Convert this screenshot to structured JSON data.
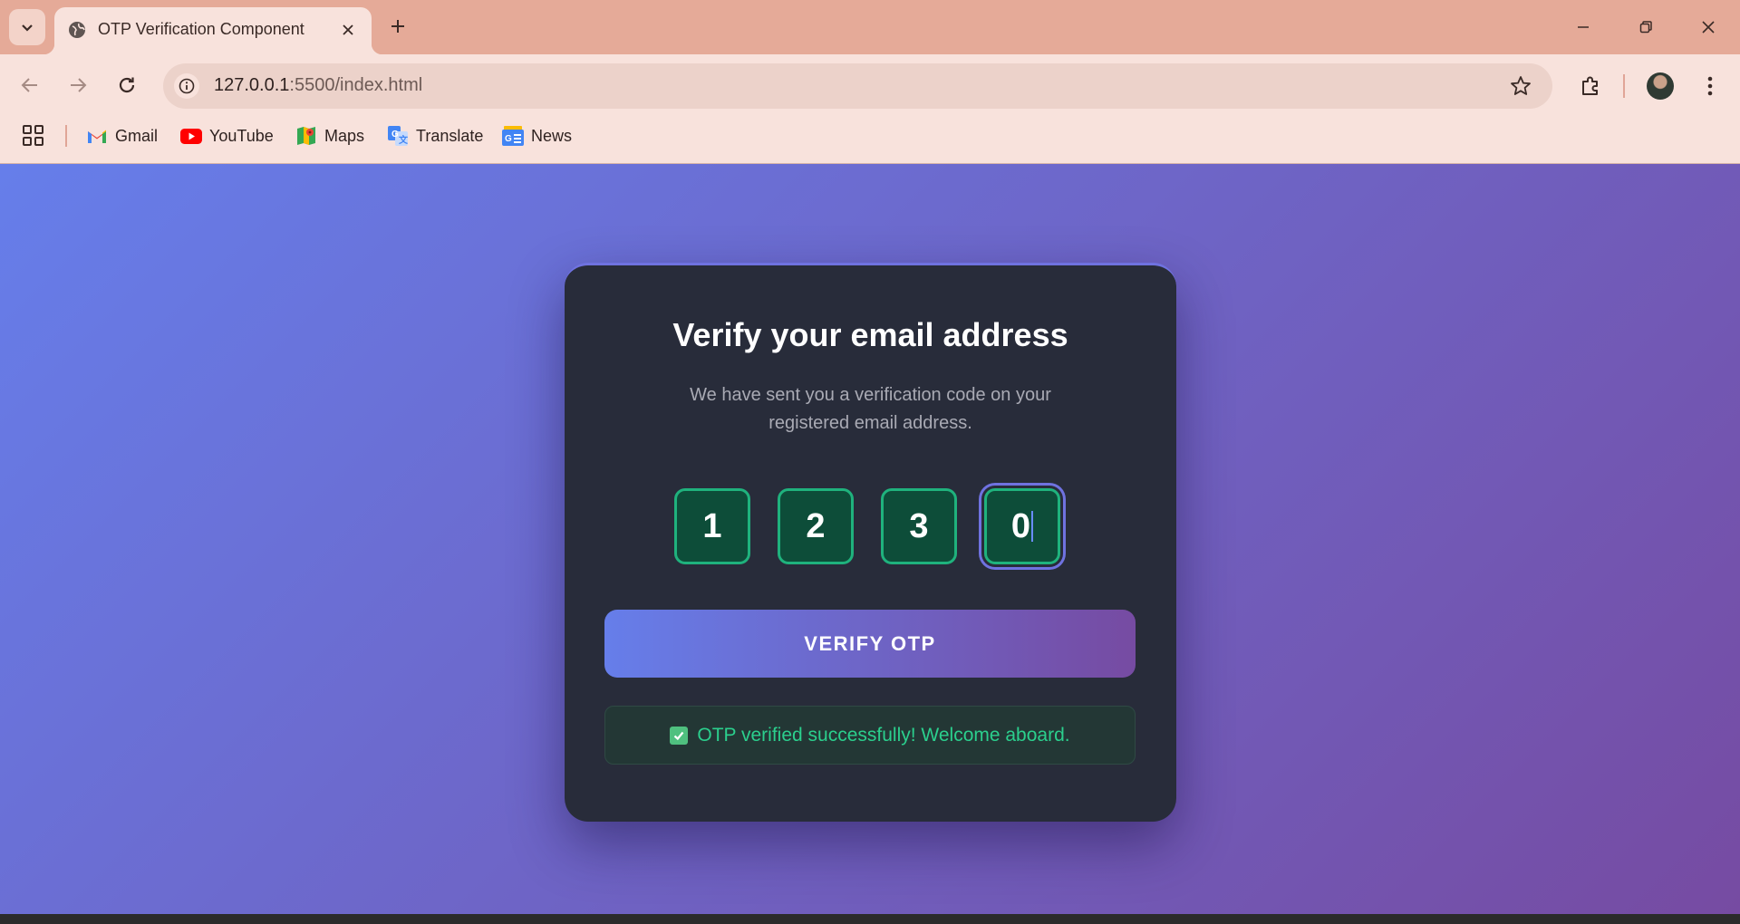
{
  "browser": {
    "tab_title": "OTP Verification Component",
    "url_host": "127.0.0.1",
    "url_path": ":5500/index.html",
    "bookmarks": [
      {
        "label": "Gmail",
        "icon": "gmail-icon"
      },
      {
        "label": "YouTube",
        "icon": "youtube-icon"
      },
      {
        "label": "Maps",
        "icon": "maps-icon"
      },
      {
        "label": "Translate",
        "icon": "translate-icon"
      },
      {
        "label": "News",
        "icon": "news-icon"
      }
    ]
  },
  "card": {
    "title": "Verify your email address",
    "subtitle": "We have sent you a verification code on your registered email address.",
    "otp_digits": [
      "1",
      "2",
      "3",
      "0"
    ],
    "focused_index": 3,
    "verify_label": "VERIFY OTP",
    "success_message": "OTP verified successfully! Welcome aboard."
  },
  "colors": {
    "gradient_start": "#667eea",
    "gradient_end": "#764ba2",
    "card_bg": "#282c3a",
    "otp_border": "#1fb27d",
    "otp_fill": "#0d4d39",
    "success_text": "#2bcf8d"
  }
}
